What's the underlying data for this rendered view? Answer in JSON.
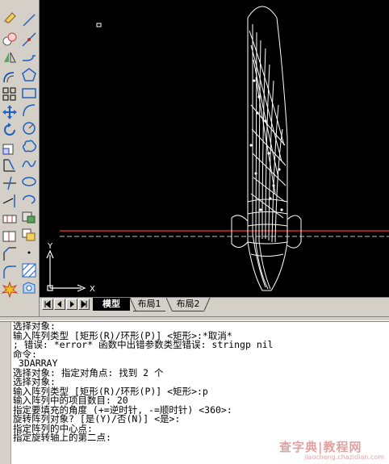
{
  "tabs": {
    "model": "模型",
    "layout1": "布局1",
    "layout2": "布局2"
  },
  "ucs": {
    "x_label": "X",
    "y_label": "Y"
  },
  "toolbar_letter": "A",
  "command_lines": [
    "选择对象:",
    "输入阵列类型 [矩形(R)/环形(P)] <矩形>:*取消*",
    "; 错误: *error* 函数中出错参数类型错误: stringp nil",
    "命令:",
    "_3DARRAY",
    "选择对象: 指定对角点: 找到 2 个",
    "选择对象:",
    "输入阵列类型 [矩形(R)/环形(P)] <矩形>:p",
    "输入阵列中的项目数目: 20",
    "指定要填充的角度 (+=逆时针, -=顺时针) <360>:",
    "旋转阵列对象? [是(Y)/否(N)] <是>:",
    "指定阵列的中心点:",
    "指定旋转轴上的第二点:"
  ],
  "watermark": {
    "text": "查字典|教程网",
    "url": "jiaocheng.chazidian.com"
  },
  "colors": {
    "canvas_bg": "#000000",
    "drawing_lines": "#ffffff",
    "axis_line": "#ff3333",
    "ui_face": "#d4d0c8",
    "command_bg": "#ffffff"
  },
  "icons": {
    "toolbar1": [
      "erase-icon",
      "copy-icon",
      "mirror-icon",
      "offset-icon",
      "array-icon",
      "move-icon",
      "rotate-icon",
      "scale-icon",
      "stretch-icon",
      "trim-icon",
      "extend-icon",
      "break-icon",
      "break-at-point-icon",
      "chamfer-icon",
      "fillet-icon",
      "explode-icon"
    ],
    "toolbar2": [
      "line-icon",
      "construction-line-icon",
      "polyline-icon",
      "polygon-icon",
      "rectangle-icon",
      "arc-icon",
      "circle-icon",
      "revision-cloud-icon",
      "spline-icon",
      "ellipse-icon",
      "ellipse-arc-icon",
      "insert-block-icon",
      "make-block-icon",
      "point-icon",
      "hatch-icon",
      "region-icon",
      "multiline-text-icon"
    ]
  }
}
